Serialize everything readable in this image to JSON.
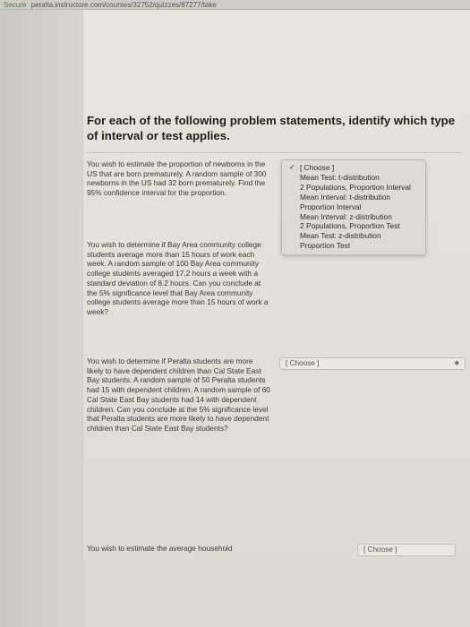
{
  "address_bar": {
    "secure_label": "Secure",
    "url": "peralta.instructure.com/courses/32752/quizzes/87277/take"
  },
  "heading": "For each of the following problem statements, identify which type of interval or test applies.",
  "questions": [
    {
      "text": "You wish to estimate the proportion of newborns in the US that are born prematurely. A random sample of 300 newborns in the US had 32 born prematurely. Find the 95% confidence interval for the proportion."
    },
    {
      "text": "You wish to determine if Bay Area community college students average more than 15 hours of work each week. A random sample of 100 Bay Area community college students averaged 17.2 hours a week with a standard deviation of 8.2 hours. Can you conclude at the 5% significance level that Bay Area community college students average more than 15 hours of work a week?"
    },
    {
      "text": "You wish to determine if Peralta students are more likely to have dependent children than Cal State East Bay students. A random sample of 50 Peralta students had 15 with dependent children. A random sample of 60 Cal State East Bay students had 14 with dependent children. Can you conclude at the 5% significance level that Peralta students are more likely to have dependent children than Cal State East Bay students?",
      "select_value": "[ Choose ]"
    },
    {
      "text": "You wish to estimate the average household",
      "select_value": "[ Choose ]"
    }
  ],
  "dropdown": {
    "options": [
      {
        "label": "[ Choose ]",
        "checked": true
      },
      {
        "label": "Mean Test: t-distribution",
        "checked": false
      },
      {
        "label": "2 Populations, Proportion Interval",
        "checked": false
      },
      {
        "label": "Mean Interval: t-distribution",
        "checked": false
      },
      {
        "label": "Proportion Interval",
        "checked": false
      },
      {
        "label": "Mean Interval: z-distribution",
        "checked": false
      },
      {
        "label": "2 Populations, Proportion Test",
        "checked": false
      },
      {
        "label": "Mean Test: z-distribution",
        "checked": false
      },
      {
        "label": "Proportion Test",
        "checked": false
      }
    ]
  },
  "icons": {
    "check": "✓",
    "select_arrows": "◆",
    "lock": "lock-icon"
  }
}
